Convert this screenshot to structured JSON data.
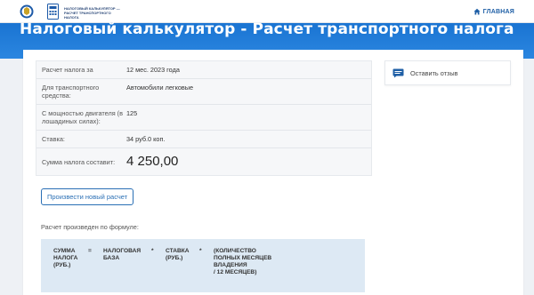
{
  "header": {
    "logo_text_line1": "НАЛОГОВЫЙ КАЛЬКУЛЯТОР —",
    "logo_text_line2": "РАСЧЕТ ТРАНСПОРТНОГО",
    "logo_text_line3": "НАЛОГА",
    "home_label": "ГЛАВНАЯ"
  },
  "page": {
    "title": "Налоговый калькулятор - Расчет транспортного налога"
  },
  "result": {
    "rows": [
      {
        "label": "Расчет налога за",
        "value": "12 мес. 2023 года"
      },
      {
        "label": "Для транспортного средства:",
        "value": "Автомобили легковые"
      },
      {
        "label": "С мощностью двигателя (в лошадиных силах):",
        "value": "125"
      },
      {
        "label": "Ставка:",
        "value": "34 руб.0 коп."
      }
    ],
    "total_label": "Сумма налога составит:",
    "total_value": "4 250,00"
  },
  "actions": {
    "recalc_label": "Произвести новый расчет"
  },
  "formula": {
    "caption": "Расчет произведен по формуле:",
    "sum_label": "СУММА\nНАЛОГА\n(РУБ.)",
    "eq": "=",
    "base_label": "НАЛОГОВАЯ\nБАЗА",
    "mul1": "*",
    "rate_label": "СТАВКА\n(РУБ.)",
    "mul2": "*",
    "months_label": "(КОЛИЧЕСТВО\nПОЛНЫХ МЕСЯЦЕВ\nВЛАДЕНИЯ\n/ 12 МЕСЯЦЕВ)"
  },
  "sidebar": {
    "feedback_label": "Оставить отзыв"
  },
  "colors": {
    "band": "#1a74d2",
    "link": "#1f5fa6",
    "formula_bg": "#dde9f4"
  },
  "icons": {
    "emblem": "fns-emblem-icon",
    "doc": "calculator-doc-icon",
    "home": "home-icon",
    "feedback": "chat-bubble-icon"
  }
}
